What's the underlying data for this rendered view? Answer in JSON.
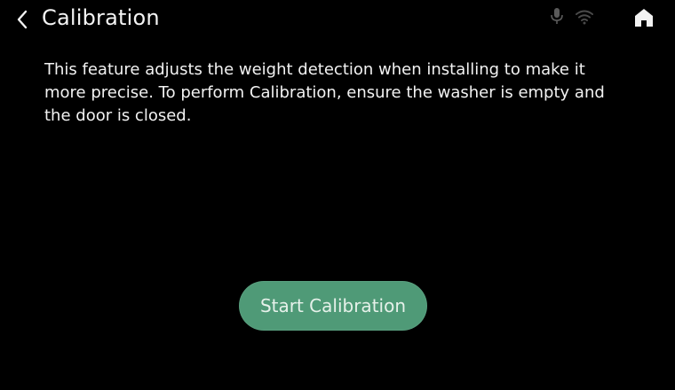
{
  "header": {
    "title": "Calibration",
    "back_icon": "chevron-left-icon",
    "status_icons": [
      "microphone-icon",
      "wifi-icon"
    ],
    "home_icon": "home-icon"
  },
  "main": {
    "description": "This feature adjusts the weight detection when installing to make it more precise. To perform Calibration, ensure the washer is empty and the door is closed.",
    "start_button_label": "Start Calibration"
  },
  "colors": {
    "background": "#000000",
    "accent": "#4f9a77",
    "text": "#f2f2f2",
    "status_icon": "#5a5a5a"
  }
}
